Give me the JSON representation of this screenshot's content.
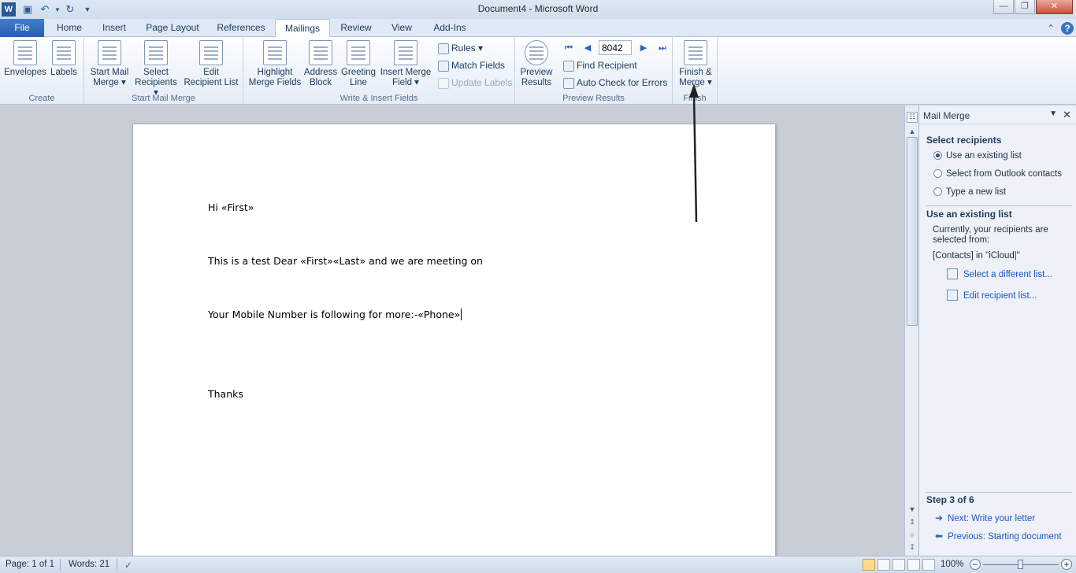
{
  "window": {
    "title": "Document4  -  Microsoft Word"
  },
  "tabs": [
    {
      "label": "File"
    },
    {
      "label": "Home"
    },
    {
      "label": "Insert"
    },
    {
      "label": "Page Layout"
    },
    {
      "label": "References"
    },
    {
      "label": "Mailings"
    },
    {
      "label": "Review"
    },
    {
      "label": "View"
    },
    {
      "label": "Add-Ins"
    }
  ],
  "ribbon": {
    "create": {
      "label": "Create",
      "envelopes": "Envelopes",
      "labels": "Labels"
    },
    "start": {
      "label": "Start Mail Merge",
      "start_l1": "Start Mail",
      "start_l2": "Merge",
      "select_l1": "Select",
      "select_l2": "Recipients",
      "edit_l1": "Edit",
      "edit_l2": "Recipient List"
    },
    "write": {
      "label": "Write & Insert Fields",
      "highlight_l1": "Highlight",
      "highlight_l2": "Merge Fields",
      "address_l1": "Address",
      "address_l2": "Block",
      "greeting_l1": "Greeting",
      "greeting_l2": "Line",
      "insert_l1": "Insert Merge",
      "insert_l2": "Field",
      "rules": "Rules",
      "match": "Match Fields",
      "update": "Update Labels"
    },
    "preview": {
      "label": "Preview Results",
      "preview_l1": "Preview",
      "preview_l2": "Results",
      "record": "8042",
      "find": "Find Recipient",
      "auto": "Auto Check for Errors"
    },
    "finish": {
      "label": "Finish",
      "finish_l1": "Finish &",
      "finish_l2": "Merge"
    }
  },
  "document": {
    "line1": "Hi «First»",
    "line2": "This is a test Dear «First»«Last»  and we are meeting on",
    "line3": "Your Mobile Number is following for more:-«Phone»",
    "line4": "Thanks"
  },
  "pane": {
    "title": "Mail Merge",
    "select_heading": "Select recipients",
    "opt_existing": "Use an existing list",
    "opt_outlook": "Select from Outlook contacts",
    "opt_new": "Type a new list",
    "use_heading": "Use an existing list",
    "desc1": "Currently, your recipients are",
    "desc2": "selected from:",
    "source": "[Contacts] in \"iCloud|\"",
    "link_select": "Select a different list...",
    "link_edit": "Edit recipient list...",
    "step": "Step 3 of 6",
    "next": "Next: Write your letter",
    "prev": "Previous: Starting document"
  },
  "status": {
    "page": "Page: 1 of 1",
    "words": "Words: 21",
    "zoom": "100%"
  }
}
